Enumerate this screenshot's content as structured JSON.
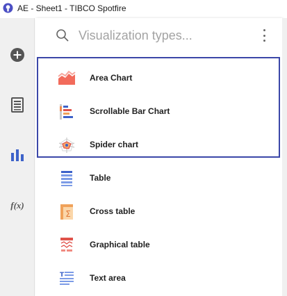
{
  "window": {
    "title": "AE - Sheet1 - TIBCO Spotfire",
    "brand_color": "#4b4fc4"
  },
  "sidebar": {
    "items": [
      {
        "name": "add-icon"
      },
      {
        "name": "data-table-icon"
      },
      {
        "name": "visualization-icon"
      },
      {
        "name": "function-icon",
        "label": "f(x)"
      }
    ]
  },
  "search": {
    "placeholder": "Visualization types...",
    "value": ""
  },
  "visualizations": [
    {
      "label": "Area Chart",
      "icon": "area-chart-icon",
      "color": "#f26b5b"
    },
    {
      "label": "Scrollable Bar Chart",
      "icon": "scrollable-bar-chart-icon",
      "color": "#3d62c9"
    },
    {
      "label": "Spider chart",
      "icon": "spider-chart-icon",
      "color": "#f08a4b"
    },
    {
      "label": "Table",
      "icon": "table-icon",
      "color": "#5b7fe0"
    },
    {
      "label": "Cross table",
      "icon": "cross-table-icon",
      "color": "#f0a25a"
    },
    {
      "label": "Graphical table",
      "icon": "graphical-table-icon",
      "color": "#e06a6a"
    },
    {
      "label": "Text area",
      "icon": "text-area-icon",
      "color": "#5b7fe0"
    }
  ],
  "highlight_color": "#3b47a8"
}
